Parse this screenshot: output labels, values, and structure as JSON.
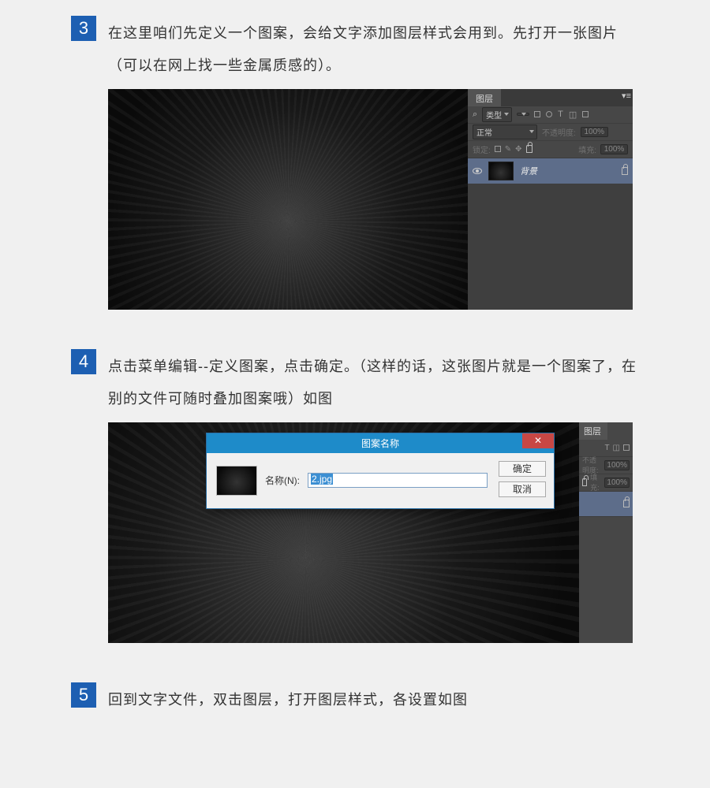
{
  "steps": {
    "s3": {
      "num": "3",
      "text": "在这里咱们先定义一个图案，会给文字添加图层样式会用到。先打开一张图片（可以在网上找一些金属质感的）。"
    },
    "s4": {
      "num": "4",
      "text": "点击菜单编辑--定义图案，点击确定。（这样的话，这张图片就是一个图案了，在别的文件可随时叠加图案哦）如图"
    },
    "s5": {
      "num": "5",
      "text": "回到文字文件，双击图层，打开图层样式，各设置如图"
    }
  },
  "panel": {
    "tab": "图层",
    "kind_label": "类型",
    "blend_label": "正常",
    "opacity_label": "不透明度:",
    "opacity_value": "100%",
    "lock_label": "锁定:",
    "fill_label": "填充:",
    "fill_value": "100%",
    "layer_name": "背景"
  },
  "dialog": {
    "title": "图案名称",
    "name_label": "名称(N):",
    "name_value": "2.jpg",
    "ok": "确定",
    "cancel": "取消"
  },
  "icons": {
    "search": "⌕",
    "menu": "≡",
    "t": "T",
    "crop": "◫",
    "dot": "•",
    "link": "⧉"
  }
}
